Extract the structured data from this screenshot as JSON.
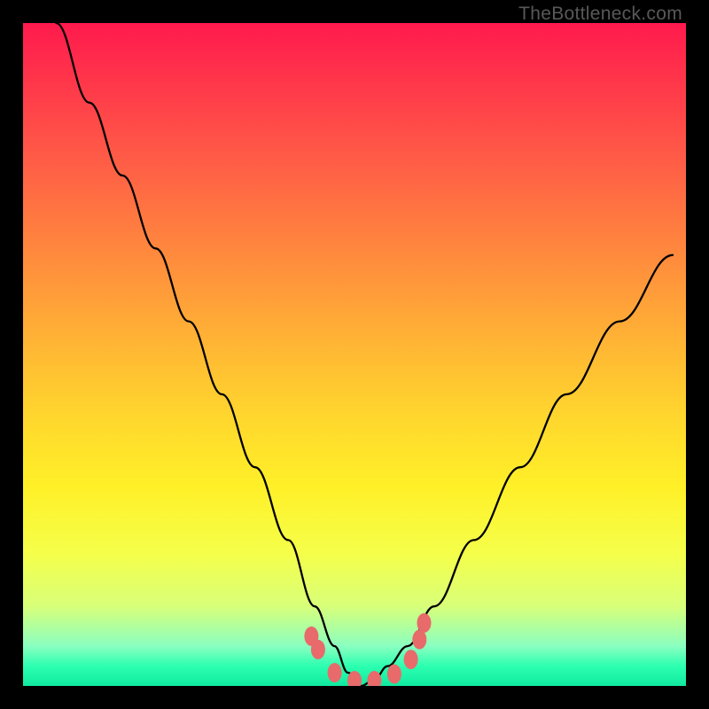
{
  "attribution": "TheBottleneck.com",
  "chart_data": {
    "type": "line",
    "title": "",
    "xlabel": "",
    "ylabel": "",
    "xlim": [
      0,
      100
    ],
    "ylim": [
      0,
      100
    ],
    "grid": false,
    "legend": false,
    "series": [
      {
        "name": "curve",
        "color": "#000000",
        "x": [
          5,
          10,
          15,
          20,
          25,
          30,
          35,
          40,
          44,
          47,
          49,
          51,
          53,
          55,
          58,
          62,
          68,
          75,
          82,
          90,
          98
        ],
        "y": [
          100,
          88,
          77,
          66,
          55,
          44,
          33,
          22,
          12,
          6,
          2,
          0,
          1,
          3,
          6,
          12,
          22,
          33,
          44,
          55,
          65
        ]
      }
    ],
    "markers": {
      "name": "bottom-dots",
      "color": "#e86a6a",
      "x": [
        43.5,
        44.5,
        47,
        50,
        53,
        56,
        58.5,
        59.8,
        60.5
      ],
      "y": [
        7.5,
        5.5,
        2.0,
        0.8,
        0.8,
        1.8,
        4.0,
        7.0,
        9.5
      ]
    },
    "background_gradient": {
      "top": "#ff1a4d",
      "mid": "#ffd82d",
      "bottom": "#10eaa0"
    }
  }
}
